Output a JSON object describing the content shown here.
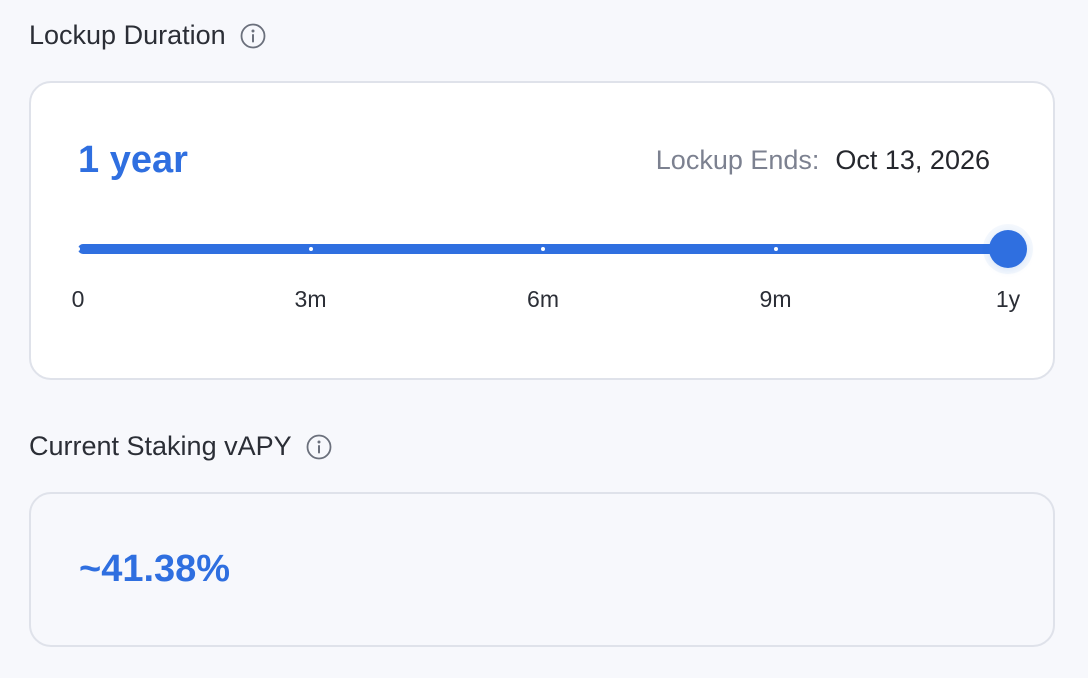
{
  "lockup": {
    "title": "Lockup Duration",
    "info_icon": "info-icon",
    "duration_value": "1 year",
    "ends_label": "Lockup Ends:",
    "ends_date": "Oct 13, 2026",
    "slider": {
      "value_fraction": 1.0,
      "ticks": [
        "0",
        "3m",
        "6m",
        "9m",
        "1y"
      ]
    }
  },
  "staking": {
    "title": "Current Staking vAPY",
    "info_icon": "info-icon",
    "apy_value": "~41.38%"
  },
  "colors": {
    "accent": "#2f6fe0",
    "background": "#f7f8fc",
    "card_border": "#dfe2ea",
    "muted_text": "#7c8190"
  }
}
